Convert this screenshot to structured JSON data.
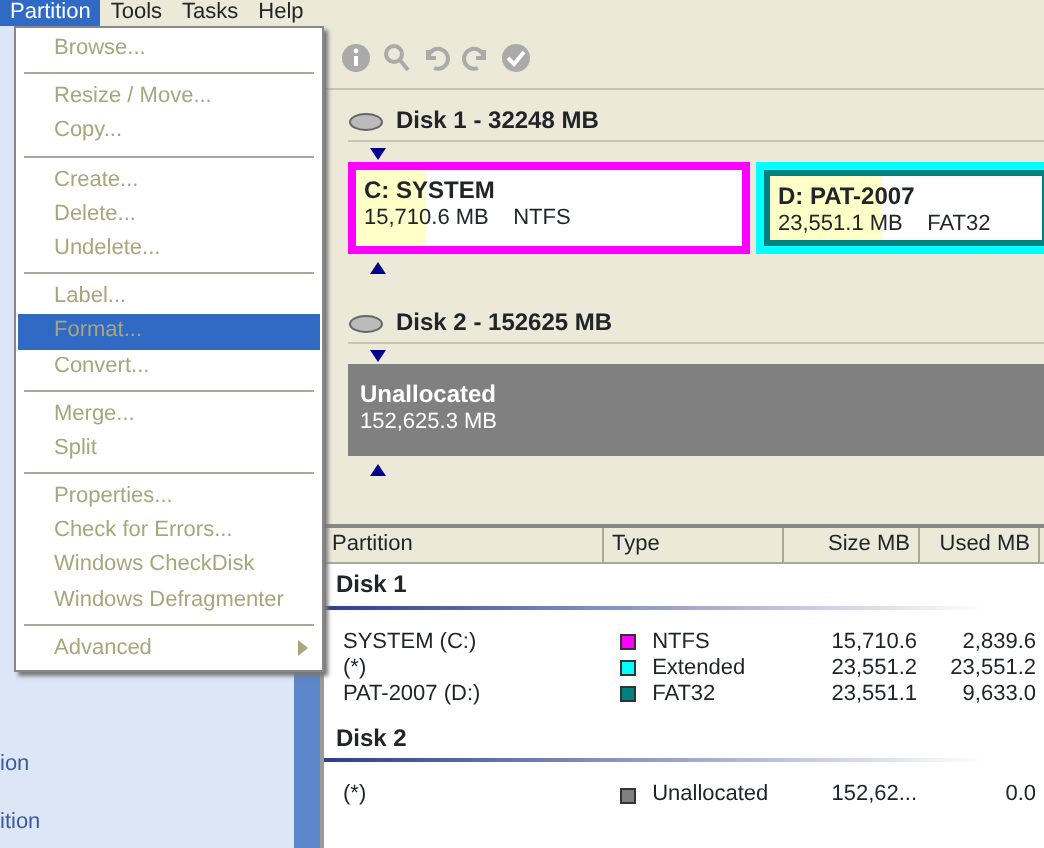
{
  "menu_bar": [
    {
      "label": "Partition",
      "selected": true
    },
    {
      "label": "Tools",
      "selected": false
    },
    {
      "label": "Tasks",
      "selected": false
    },
    {
      "label": "Help",
      "selected": false
    }
  ],
  "partition_menu": [
    [
      {
        "label": "Browse...",
        "disabled": true,
        "selected": false
      }
    ],
    [
      {
        "label": "Resize / Move...",
        "disabled": true,
        "selected": false
      },
      {
        "label": "Copy...",
        "disabled": true,
        "selected": false
      }
    ],
    [
      {
        "label": "Create...",
        "disabled": true,
        "selected": false
      },
      {
        "label": "Delete...",
        "disabled": true,
        "selected": false
      },
      {
        "label": "Undelete...",
        "disabled": true,
        "selected": false
      }
    ],
    [
      {
        "label": "Label...",
        "disabled": true,
        "selected": false
      },
      {
        "label": "Format...",
        "disabled": true,
        "selected": true
      },
      {
        "label": "Convert...",
        "disabled": true,
        "selected": false
      }
    ],
    [
      {
        "label": "Merge...",
        "disabled": true,
        "selected": false
      },
      {
        "label": "Split",
        "disabled": true,
        "selected": false
      }
    ],
    [
      {
        "label": "Properties...",
        "disabled": true,
        "selected": false
      },
      {
        "label": "Check for Errors...",
        "disabled": true,
        "selected": false
      },
      {
        "label": "Windows CheckDisk",
        "disabled": true,
        "selected": false
      },
      {
        "label": "Windows Defragmenter",
        "disabled": true,
        "selected": false
      }
    ],
    [
      {
        "label": "Advanced",
        "disabled": true,
        "selected": false,
        "submenu": true
      }
    ]
  ],
  "sidebar": {
    "items": [
      "ion",
      "ition"
    ]
  },
  "disk_map": [
    {
      "title": "Disk 1 - 32248 MB",
      "partitions": [
        {
          "name": "C:  SYSTEM",
          "size": "15,710.6 MB",
          "fs": "NTFS",
          "color": "#ff00ff",
          "level": 0.18,
          "kind": "primary"
        },
        {
          "name": "D:  PAT-2007",
          "size": "23,551.1 MB",
          "fs": "FAT32",
          "color": "#00ffff",
          "level": 0.41,
          "kind": "logical"
        }
      ]
    },
    {
      "title": "Disk 2 - 152625 MB",
      "partitions": [
        {
          "name": "Unallocated",
          "size": "152,625.3 MB",
          "kind": "unallocated"
        }
      ]
    }
  ],
  "table": {
    "columns": [
      "Partition",
      "Type",
      "Size MB",
      "Used MB"
    ],
    "groups": [
      {
        "title": "Disk 1",
        "rows": [
          {
            "partition": "SYSTEM (C:)",
            "type": "NTFS",
            "color": "#ff00ff",
            "size": "15,710.6",
            "used": "2,839.6"
          },
          {
            "partition": "(*)",
            "type": "Extended",
            "color": "#00ffff",
            "size": "23,551.2",
            "used": "23,551.2"
          },
          {
            "partition": "PAT-2007 (D:)",
            "type": "FAT32",
            "color": "#008080",
            "size": "23,551.1",
            "used": "9,633.0"
          }
        ]
      },
      {
        "title": "Disk 2",
        "rows": [
          {
            "partition": "(*)",
            "type": "Unallocated",
            "color": "#808080",
            "size": "152,62...",
            "used": "0.0"
          }
        ]
      }
    ]
  }
}
